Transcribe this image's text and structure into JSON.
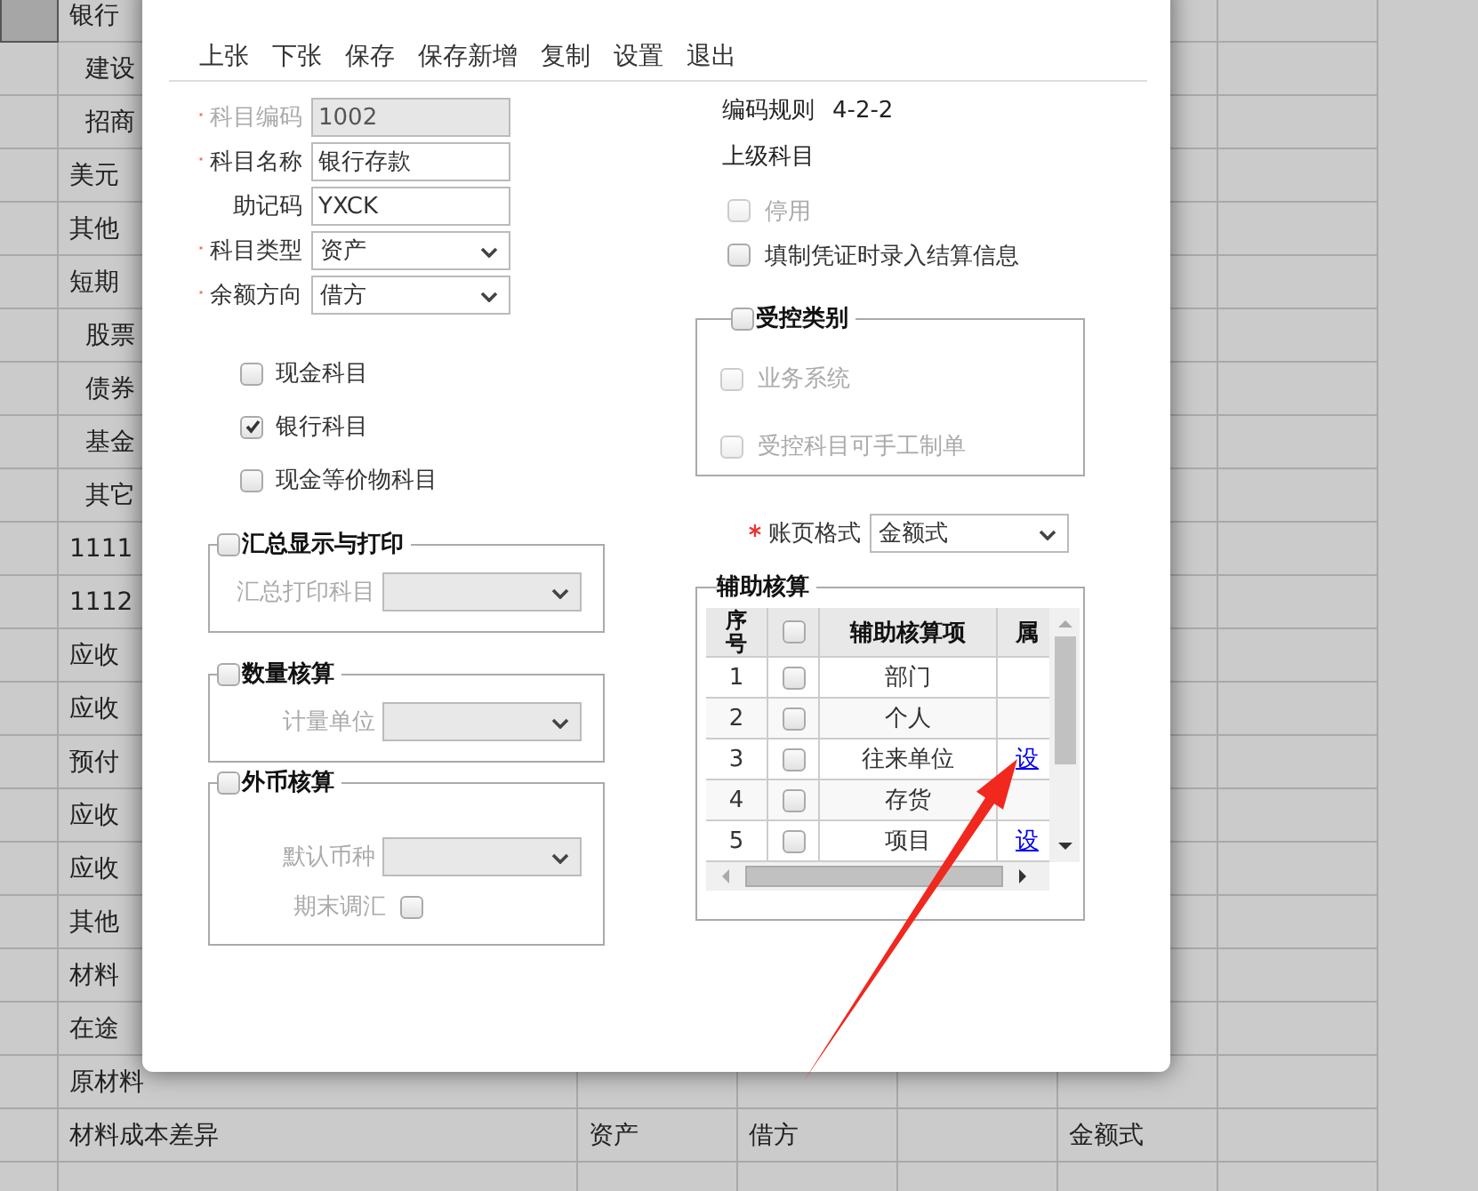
{
  "background_rows": [
    {
      "selected": true,
      "indent": false,
      "name": "银行"
    },
    {
      "selected": false,
      "indent": true,
      "name": "建设"
    },
    {
      "selected": false,
      "indent": true,
      "name": "招商"
    },
    {
      "selected": false,
      "indent": false,
      "name": "美元"
    },
    {
      "selected": false,
      "indent": false,
      "name": "其他"
    },
    {
      "selected": false,
      "indent": false,
      "name": "短期"
    },
    {
      "selected": false,
      "indent": true,
      "name": "股票"
    },
    {
      "selected": false,
      "indent": true,
      "name": "债券"
    },
    {
      "selected": false,
      "indent": true,
      "name": "基金"
    },
    {
      "selected": false,
      "indent": true,
      "name": "其它"
    },
    {
      "selected": false,
      "indent": false,
      "name": "1111"
    },
    {
      "selected": false,
      "indent": false,
      "name": "1112"
    },
    {
      "selected": false,
      "indent": false,
      "name": "应收"
    },
    {
      "selected": false,
      "indent": false,
      "name": "应收"
    },
    {
      "selected": false,
      "indent": false,
      "name": "预付"
    },
    {
      "selected": false,
      "indent": false,
      "name": "应收"
    },
    {
      "selected": false,
      "indent": false,
      "name": "应收"
    },
    {
      "selected": false,
      "indent": false,
      "name": "其他"
    },
    {
      "selected": false,
      "indent": false,
      "name": "材料"
    },
    {
      "selected": false,
      "indent": false,
      "name": "在途"
    },
    {
      "selected": false,
      "indent": false,
      "name": "原材料"
    },
    {
      "selected": false,
      "indent": false,
      "name": "材料成本差异",
      "type": "资产",
      "balance": "借方",
      "format": "金额式"
    }
  ],
  "toolbar": [
    "上张",
    "下张",
    "保存",
    "保存新增",
    "复制",
    "设置",
    "退出"
  ],
  "fields": [
    {
      "label": "科目编码",
      "required": true,
      "kind": "input",
      "value": "1002",
      "disabled": true
    },
    {
      "label": "科目名称",
      "required": true,
      "kind": "input",
      "value": "银行存款",
      "disabled": false
    },
    {
      "label": "助记码",
      "required": false,
      "kind": "input",
      "value": "YXCK",
      "disabled": false
    },
    {
      "label": "科目类型",
      "required": true,
      "kind": "select",
      "value": "资产",
      "disabled": false
    },
    {
      "label": "余额方向",
      "required": true,
      "kind": "select",
      "value": "借方",
      "disabled": false
    }
  ],
  "account_flags": [
    {
      "label": "现金科目",
      "checked": false
    },
    {
      "label": "银行科目",
      "checked": true
    },
    {
      "label": "现金等价物科目",
      "checked": false
    }
  ],
  "summary_print": {
    "legend": "汇总显示与打印",
    "checked": false,
    "field_label": "汇总打印科目"
  },
  "quantity": {
    "legend": "数量核算",
    "checked": false,
    "field_label": "计量单位"
  },
  "foreign_currency": {
    "legend": "外币核算",
    "checked": false,
    "field_label": "默认币种",
    "adjust_label": "期末调汇",
    "adjust_checked": false
  },
  "code_rule": {
    "label": "编码规则",
    "value": "4-2-2"
  },
  "parent_label": "上级科目",
  "options": [
    {
      "label": "停用",
      "checked": false,
      "disabled": true
    },
    {
      "label": "填制凭证时录入结算信息",
      "checked": false,
      "disabled": false
    }
  ],
  "controlled": {
    "legend": "受控类别",
    "checked": false,
    "items": [
      {
        "label": "业务系统",
        "checked": false,
        "disabled": true
      },
      {
        "label": "受控科目可手工制单",
        "checked": false,
        "disabled": true
      }
    ]
  },
  "ledger_format": {
    "label": "账页格式",
    "required": true,
    "value": "金额式"
  },
  "auxiliary": {
    "legend": "辅助核算",
    "columns": [
      "序号",
      "辅助核算项",
      "属"
    ],
    "header_checked": false,
    "rows": [
      {
        "no": "1",
        "checked": false,
        "item": "部门"
      },
      {
        "no": "2",
        "checked": false,
        "item": "个人"
      },
      {
        "no": "3",
        "checked": false,
        "item": "往来单位",
        "link": "设"
      },
      {
        "no": "4",
        "checked": false,
        "item": "存货"
      },
      {
        "no": "5",
        "checked": false,
        "item": "项目",
        "link": "设"
      }
    ]
  }
}
